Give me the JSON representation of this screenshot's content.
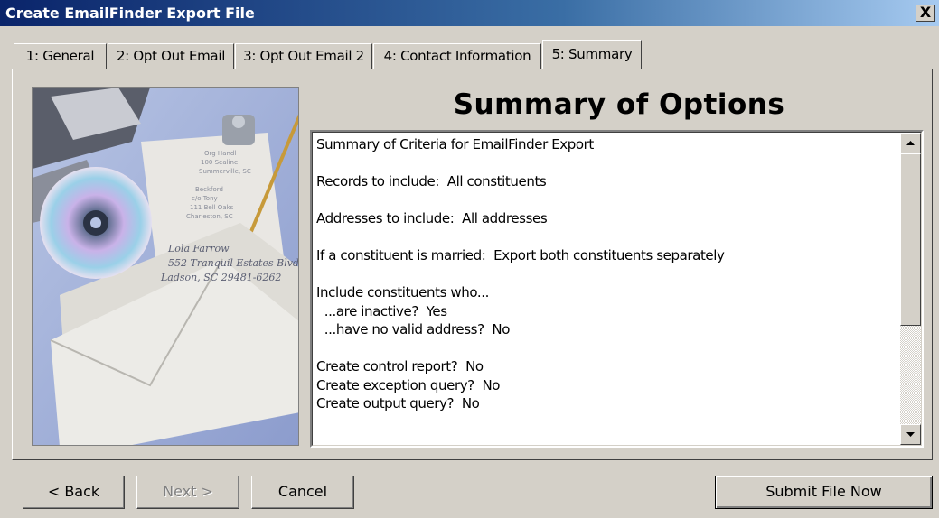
{
  "window": {
    "title": "Create EmailFinder Export File",
    "close_label": "X"
  },
  "tabs": [
    {
      "label": "1: General"
    },
    {
      "label": "2: Opt Out Email"
    },
    {
      "label": "3: Opt Out Email 2"
    },
    {
      "label": "4: Contact Information"
    },
    {
      "label": "5: Summary",
      "active": true
    }
  ],
  "image": {
    "text_lines": [
      "Lola Farrow",
      "552 Tranquil Estates Blvd",
      "Ladson, SC 29481-6262"
    ]
  },
  "main": {
    "heading": "Summary of Options",
    "summary_lines": [
      "Summary of Criteria for EmailFinder Export",
      "",
      "Records to include:  All constituents",
      "",
      "Addresses to include:  All addresses",
      "",
      "If a constituent is married:  Export both constituents separately",
      "",
      "Include constituents who...",
      "  ...are inactive?  Yes",
      "  ...have no valid address?  No",
      "",
      "Create control report?  No",
      "Create exception query?  No",
      "Create output query?  No"
    ]
  },
  "buttons": {
    "back": "< Back",
    "next": "Next >",
    "cancel": "Cancel",
    "submit": "Submit File Now"
  },
  "colors": {
    "titlebar": "#0a246a",
    "face": "#d4d0c8"
  }
}
